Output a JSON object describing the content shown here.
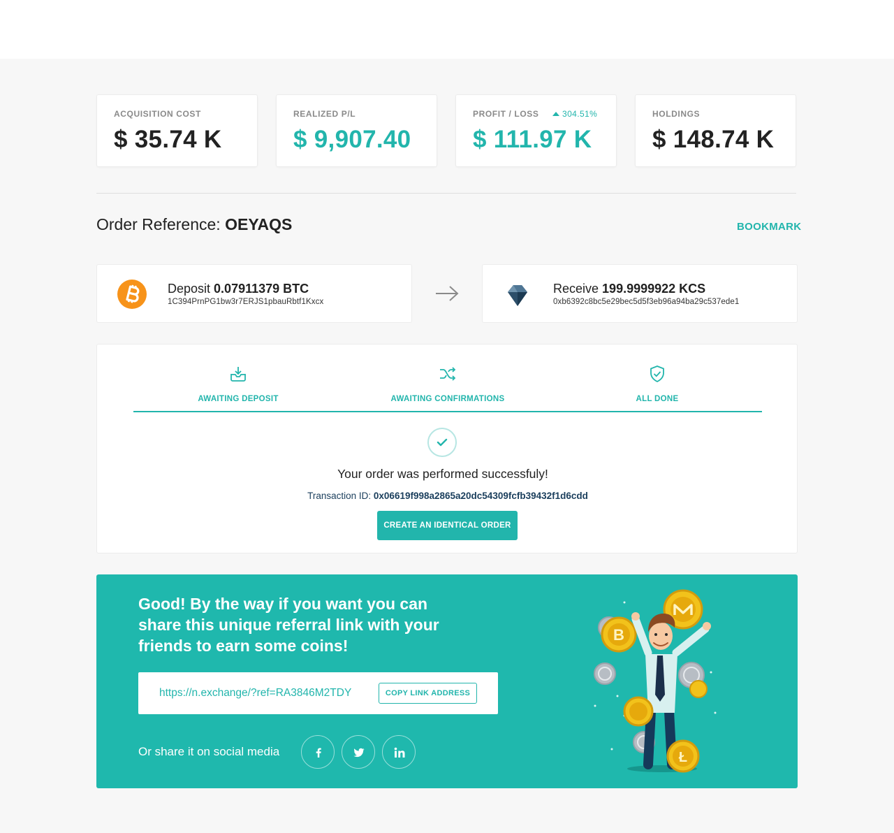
{
  "stats": [
    {
      "label": "ACQUISITION COST",
      "value": "$ 35.74 K"
    },
    {
      "label": "REALIZED P/L",
      "value": "$ 9,907.40"
    },
    {
      "label": "PROFIT / LOSS",
      "value": "$ 111.97 K",
      "change": "304.51%"
    },
    {
      "label": "HOLDINGS",
      "value": "$ 148.74 K"
    }
  ],
  "order": {
    "reference_label": "Order Reference:",
    "reference_code": "OEYAQS",
    "bookmark_label": "BOOKMARK"
  },
  "deposit": {
    "verb": "Deposit",
    "amount": "0.07911379 BTC",
    "address": "1C394PrnPG1bw3r7ERJS1pbauRbtf1Kxcx",
    "icon": "bitcoin-icon"
  },
  "receive": {
    "verb": "Receive",
    "amount": "199.9999922 KCS",
    "address": "0xb6392c8bc5e29bec5d5f3eb96a94ba29c537ede1",
    "icon": "kucoin-diamond-icon"
  },
  "steps": [
    {
      "label": "AWAITING DEPOSIT",
      "icon": "inbox-download-icon"
    },
    {
      "label": "AWAITING CONFIRMATIONS",
      "icon": "shuffle-icon"
    },
    {
      "label": "ALL DONE",
      "icon": "shield-check-icon"
    }
  ],
  "result": {
    "message": "Your order was performed successfuly!",
    "tx_label": "Transaction ID:",
    "tx_id": "0x06619f998a2865a20dc54309fcfb39432f1d6cdd",
    "create_button": "CREATE AN IDENTICAL ORDER"
  },
  "referral": {
    "headline": "Good! By the way if you want you can share this unique referral link with your friends to earn some coins!",
    "link": "https://n.exchange/?ref=RA3846M2TDY",
    "copy_button": "COPY LINK ADDRESS",
    "share_label": "Or share it on social media",
    "social": [
      "facebook-icon",
      "twitter-icon",
      "linkedin-icon"
    ]
  },
  "colors": {
    "accent": "#22b5ac",
    "banner": "#1fb8ad",
    "bitcoin": "#f7931a",
    "text_dark": "#222222"
  }
}
